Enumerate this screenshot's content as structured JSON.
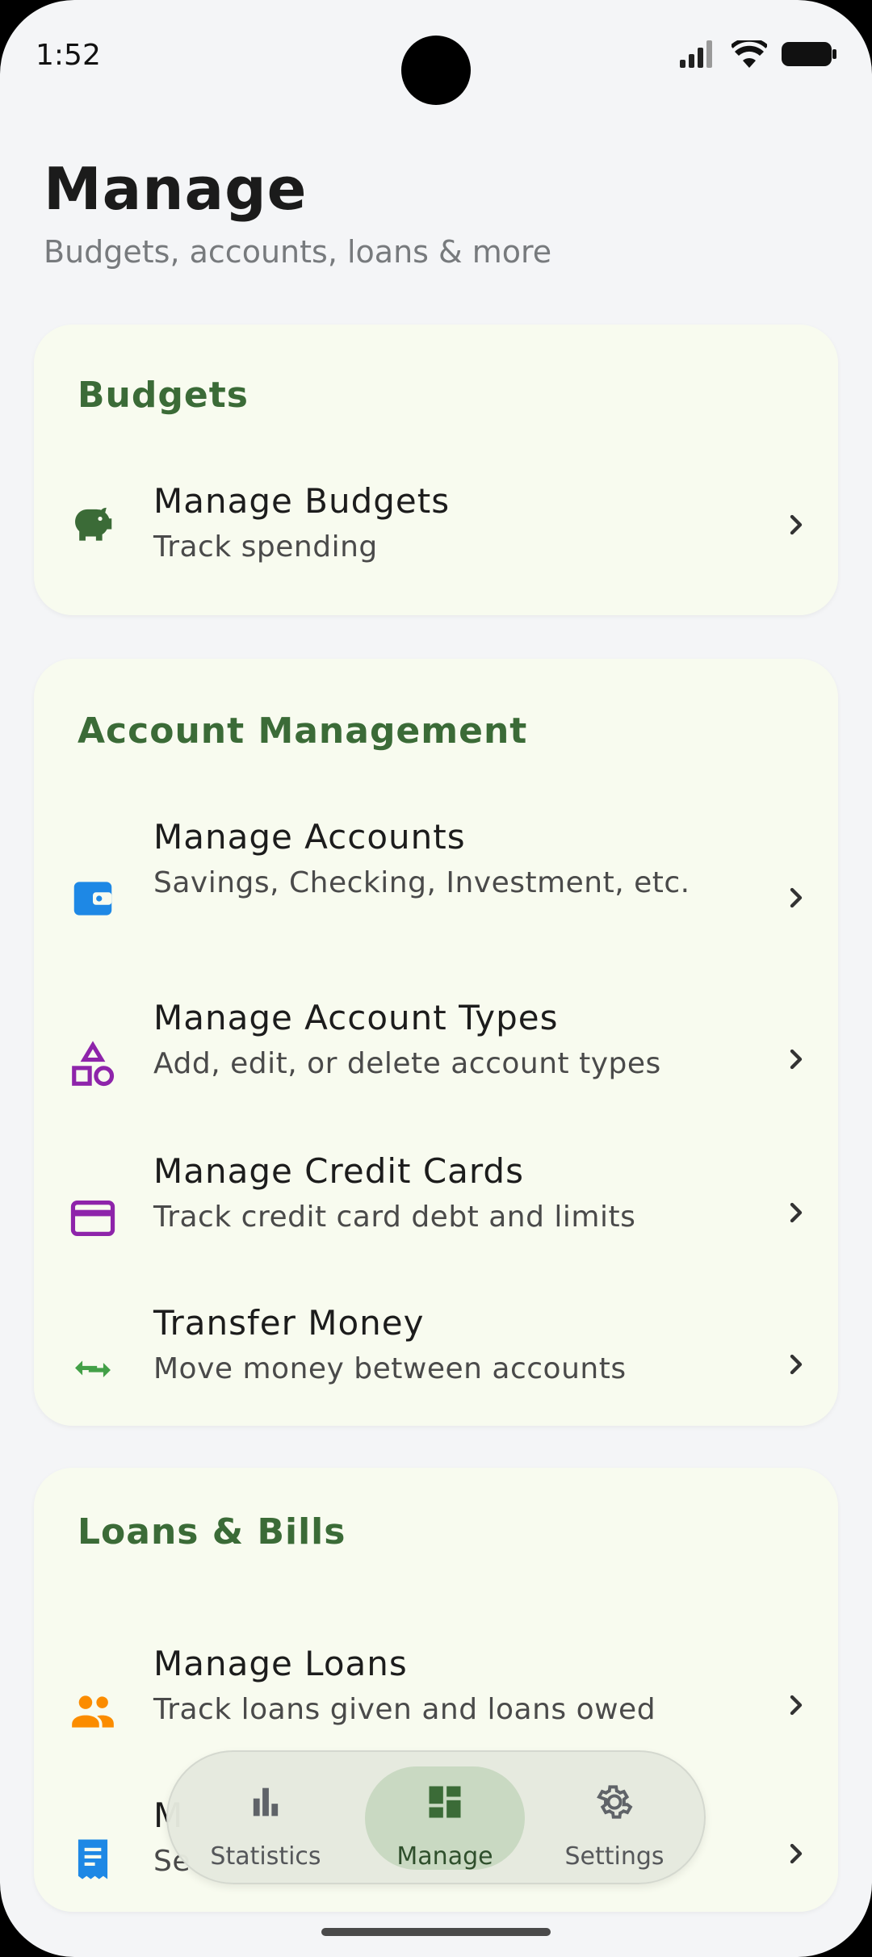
{
  "status": {
    "time": "1:52"
  },
  "header": {
    "title": "Manage",
    "subtitle": "Budgets, accounts, loans & more"
  },
  "sections": [
    {
      "title": "Budgets",
      "items": [
        {
          "title": "Manage Budgets",
          "subtitle": "Track spending",
          "icon": "piggy-bank-icon",
          "color": "#3b6b37"
        }
      ]
    },
    {
      "title": "Account Management",
      "items": [
        {
          "title": "Manage Accounts",
          "subtitle": "Savings, Checking, Investment, etc.",
          "icon": "wallet-icon",
          "color": "#1e88e5"
        },
        {
          "title": "Manage Account Types",
          "subtitle": "Add, edit, or delete account types",
          "icon": "category-shapes-icon",
          "color": "#8e24aa"
        },
        {
          "title": "Manage Credit Cards",
          "subtitle": "Track credit card debt and limits",
          "icon": "credit-card-icon",
          "color": "#8e24aa"
        },
        {
          "title": "Transfer Money",
          "subtitle": "Move money between accounts",
          "icon": "swap-arrows-icon",
          "color": "#43a047"
        }
      ]
    },
    {
      "title": "Loans & Bills",
      "items": [
        {
          "title": "Manage Loans",
          "subtitle": "Track loans given and loans owed",
          "icon": "people-icon",
          "color": "#fb8c00"
        },
        {
          "title": "M",
          "subtitle": "Se",
          "icon": "receipt-icon",
          "color": "#1e88e5"
        }
      ]
    }
  ],
  "nav": {
    "items": [
      {
        "label": "Statistics",
        "icon": "bar-chart-icon"
      },
      {
        "label": "Manage",
        "icon": "dashboard-icon",
        "active": true
      },
      {
        "label": "Settings",
        "icon": "gear-icon"
      }
    ],
    "active_color": "#3b6b37"
  }
}
